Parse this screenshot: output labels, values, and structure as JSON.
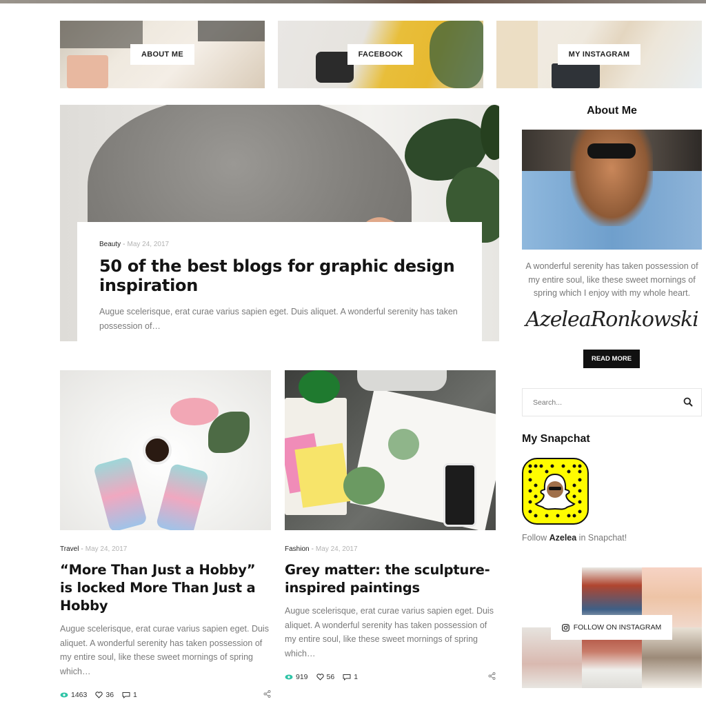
{
  "tiles": [
    {
      "label": "ABOUT ME"
    },
    {
      "label": "FACEBOOK"
    },
    {
      "label": "MY INSTAGRAM"
    }
  ],
  "featured": {
    "category": "Beauty",
    "separator": "-",
    "date": "May 24, 2017",
    "title": "50 of the best blogs for graphic design inspiration",
    "excerpt": "Augue scelerisque, erat curae varius sapien eget. Duis aliquet. A wonderful serenity has taken possession of…"
  },
  "posts": [
    {
      "category": "Travel",
      "separator": "-",
      "date": "May 24, 2017",
      "title": "“More Than Just a Hobby” is locked More Than Just a Hobby",
      "excerpt": "Augue scelerisque, erat curae varius sapien eget. Duis aliquet. A wonderful serenity has taken possession of my entire soul, like these sweet mornings of spring which…",
      "views": "1463",
      "likes": "36",
      "comments": "1"
    },
    {
      "category": "Fashion",
      "separator": "-",
      "date": "May 24, 2017",
      "title": "Grey matter: the sculpture-inspired paintings",
      "excerpt": "Augue scelerisque, erat curae varius sapien eget. Duis aliquet. A wonderful serenity has taken possession of my entire soul, like these sweet mornings of spring which…",
      "views": "919",
      "likes": "56",
      "comments": "1"
    }
  ],
  "sidebar": {
    "about_title": "About Me",
    "about_text": "A wonderful serenity has taken possession of my entire soul, like these sweet mornings of spring which I enjoy with my whole heart.",
    "signature": "AzeleaRonkowski",
    "read_more": "READ MORE",
    "search_placeholder": "Search...",
    "snapchat_title": "My Snapchat",
    "snap_follow_prefix": "Follow ",
    "snap_follow_name": "Azelea",
    "snap_follow_suffix": " in Snapchat!",
    "instagram_follow": "FOLLOW ON INSTAGRAM"
  },
  "colors": {
    "accent_views": "#2ec4a6",
    "snapchat_yellow": "#fffc00",
    "dark_button": "#111111"
  },
  "icons": [
    "search-icon",
    "eye-icon",
    "heart-icon",
    "comment-icon",
    "share-icon",
    "instagram-icon"
  ]
}
